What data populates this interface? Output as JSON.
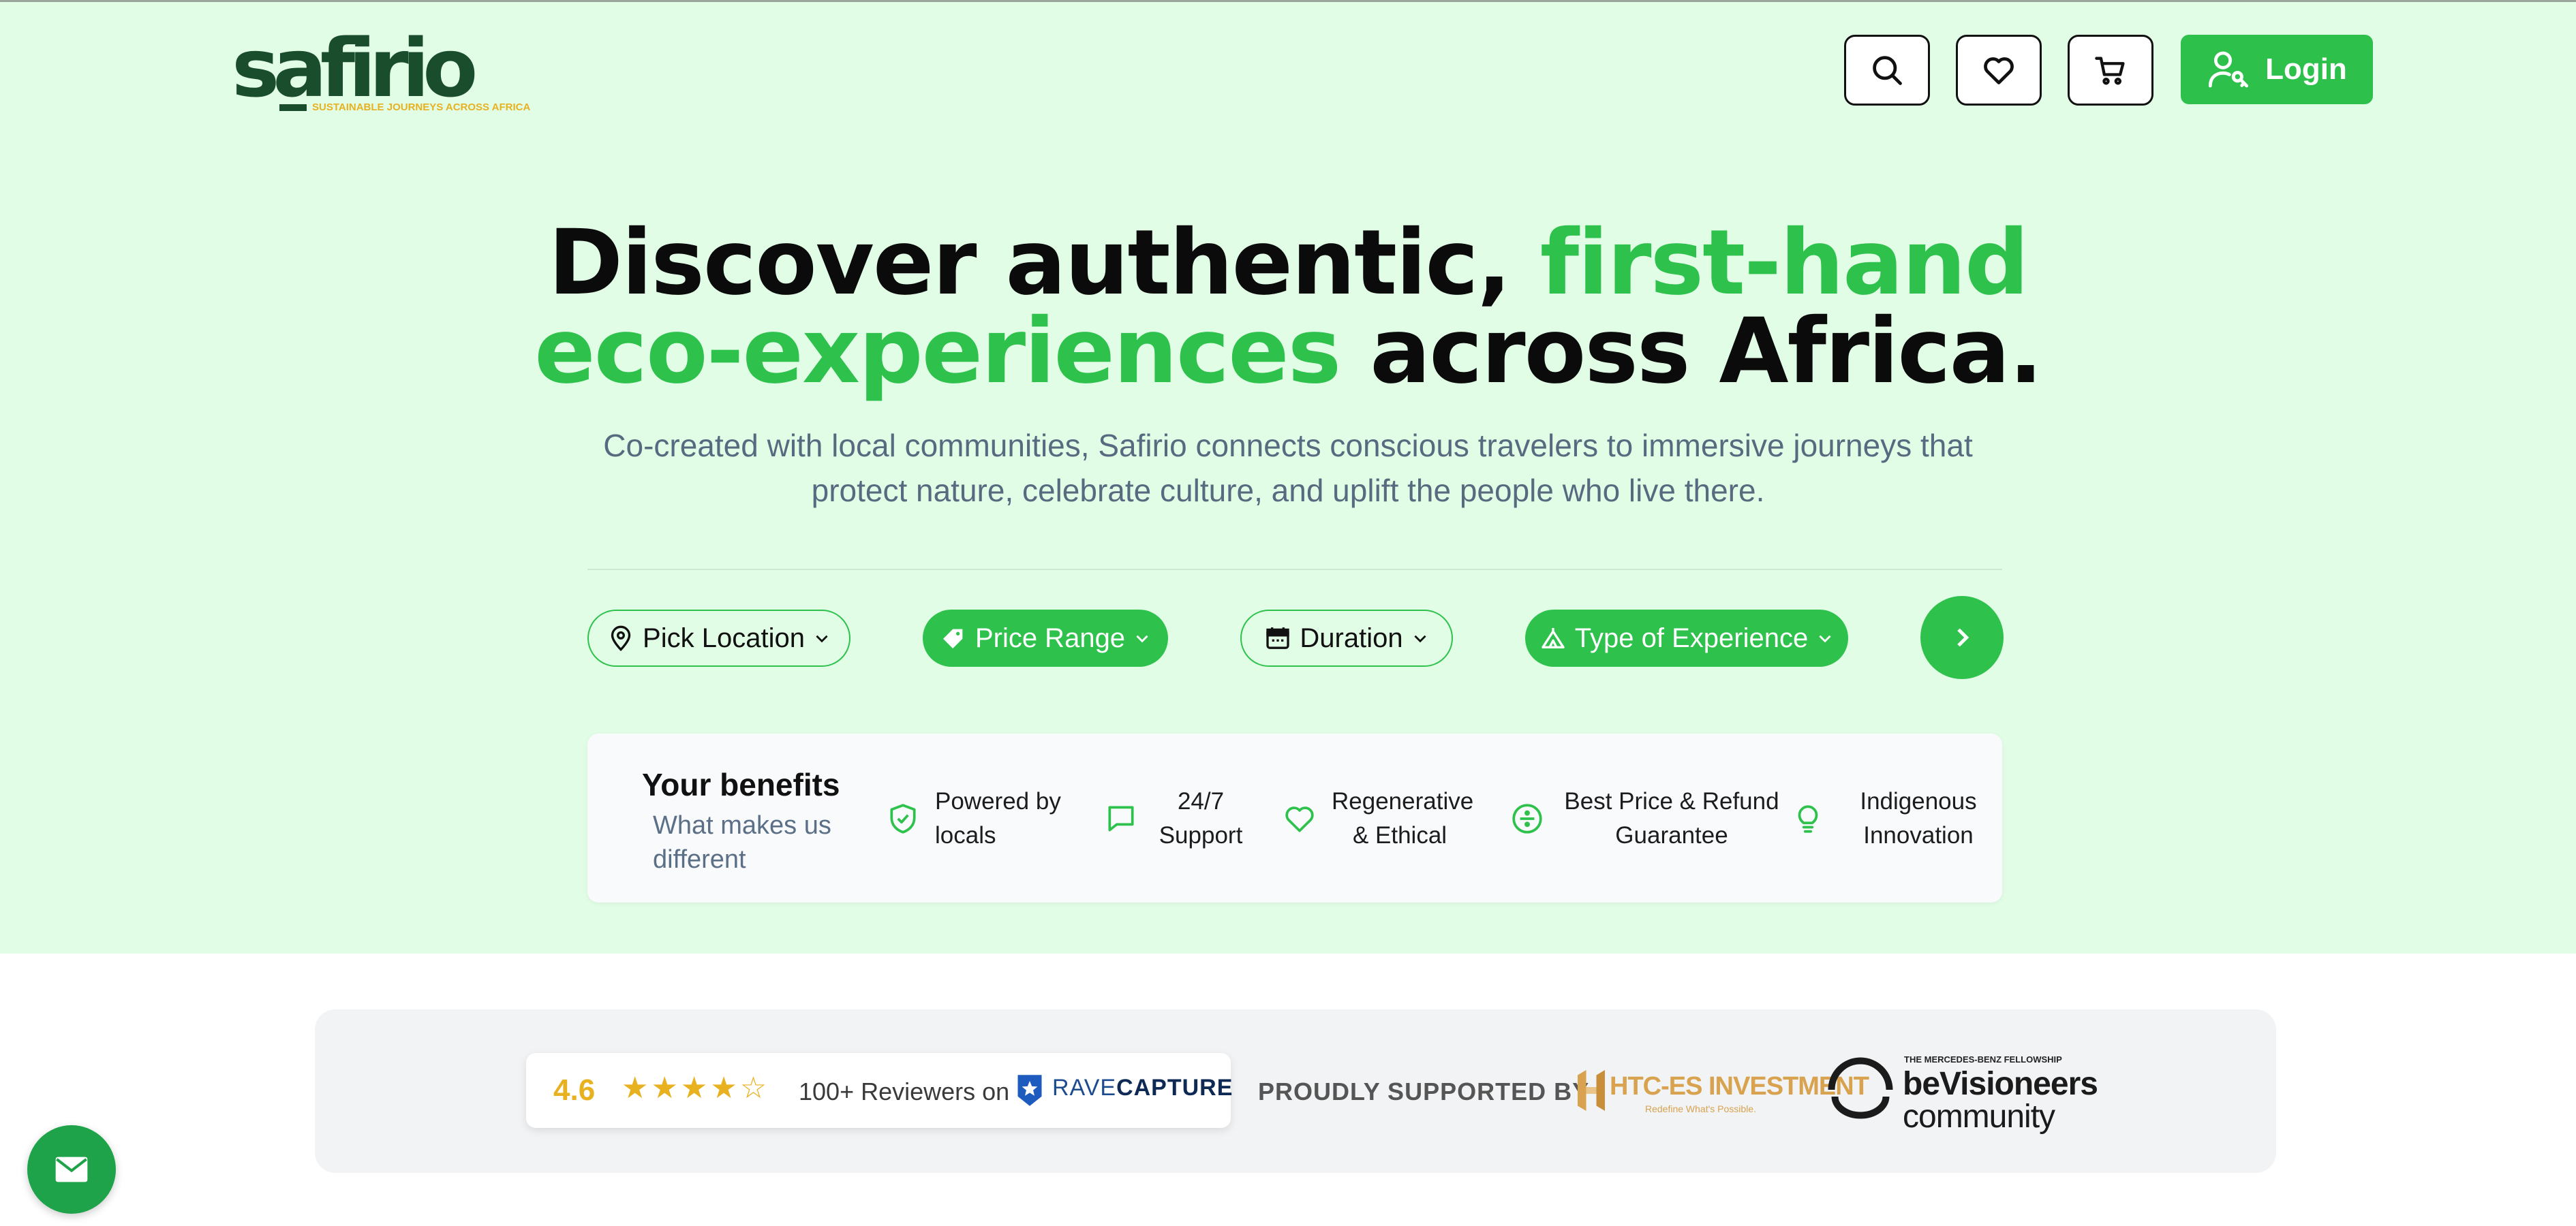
{
  "brand": {
    "name": "safirio",
    "tagline": "SUSTAINABLE JOURNEYS ACROSS AFRICA"
  },
  "header": {
    "search_icon": "search-icon",
    "wishlist_icon": "heart-icon",
    "cart_icon": "cart-icon",
    "login_label": "Login"
  },
  "hero": {
    "headline_part1": "Discover authentic, ",
    "headline_highlight1": "first-hand",
    "headline_highlight2": "eco-experiences",
    "headline_part2": " across Africa.",
    "subtitle": "Co-created with local communities, Safirio connects conscious travelers to immersive journeys that protect nature, celebrate culture, and uplift the people who live there."
  },
  "filters": {
    "location": "Pick Location",
    "price": "Price Range",
    "duration": "Duration",
    "experience": "Type of Experience"
  },
  "benefits": {
    "title": "Your benefits",
    "subtitle": "What makes us different",
    "items": [
      {
        "label": "Powered by locals",
        "icon": "shield-check-icon"
      },
      {
        "label": "24/7 Support",
        "icon": "chat-icon"
      },
      {
        "label": "Regenerative & Ethical",
        "icon": "heart-icon"
      },
      {
        "label": "Best Price & Refund Guarantee",
        "icon": "divide-circle-icon"
      },
      {
        "label": "Indigenous Innovation",
        "icon": "lightbulb-icon"
      }
    ]
  },
  "reviews": {
    "rating": "4.6",
    "stars": "★★★★☆",
    "reviewers": "100+ Reviewers on",
    "platform_prefix": "RAVE",
    "platform_suffix": "CAPTURE",
    "supported_by": "PROUDLY SUPPORTED BY",
    "sponsor1_name": "HTC-ES INVESTMENT",
    "sponsor1_tag": "Redefine What's Possible.",
    "sponsor2_small": "THE MERCEDES-BENZ FELLOWSHIP",
    "sponsor2_title": "beVisioneers",
    "sponsor2_sub": "community"
  },
  "colors": {
    "accent": "#2ec24d",
    "hero_bg": "#e2fde6",
    "star": "#e8b11f"
  }
}
